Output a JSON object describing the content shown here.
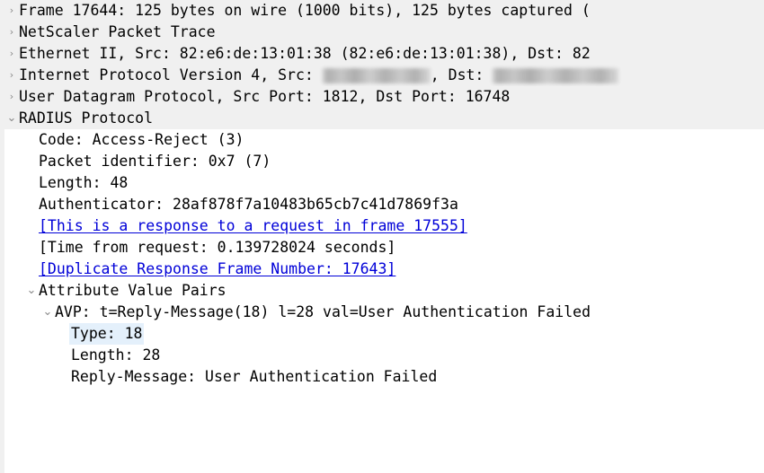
{
  "pane": {
    "name": "Wireshark packet details tree",
    "background": "#ffffff",
    "shaded_row_background": "#f0f0f0",
    "selection_background": "#e4f0fb",
    "link_color": "#0000d8",
    "twisty_collapsed": "›",
    "twisty_expanded": "⌄"
  },
  "rows": [
    {
      "id": "frame",
      "indent": 0,
      "twisty": "collapsed",
      "shaded": true,
      "link": false,
      "selected": false,
      "text": "Frame 17644: 125 bytes on wire (1000 bits), 125 bytes captured ("
    },
    {
      "id": "netscaler-packet-trace",
      "indent": 0,
      "twisty": "collapsed",
      "shaded": true,
      "link": false,
      "selected": false,
      "text": "NetScaler Packet Trace"
    },
    {
      "id": "ethernet-ii",
      "indent": 0,
      "twisty": "collapsed",
      "shaded": true,
      "link": false,
      "selected": false,
      "text": "Ethernet II, Src: 82:e6:de:13:01:38 (82:e6:de:13:01:38), Dst: 82"
    },
    {
      "id": "internet-protocol-version-4",
      "indent": 0,
      "twisty": "collapsed",
      "shaded": true,
      "link": false,
      "selected": false,
      "redacted": true,
      "text_before_src": "Internet Protocol Version 4, Src: ",
      "text_between": ", Dst: ",
      "src_redacted_width": 120,
      "dst_redacted_width": 140
    },
    {
      "id": "user-datagram-protocol",
      "indent": 0,
      "twisty": "collapsed",
      "shaded": true,
      "link": false,
      "selected": false,
      "text": "User Datagram Protocol, Src Port: 1812, Dst Port: 16748"
    },
    {
      "id": "radius-protocol",
      "indent": 0,
      "twisty": "expanded",
      "shaded": true,
      "link": false,
      "selected": false,
      "text": "RADIUS Protocol"
    },
    {
      "id": "radius-code",
      "indent": 1,
      "twisty": "none",
      "shaded": false,
      "link": false,
      "selected": false,
      "text": "Code: Access-Reject (3)"
    },
    {
      "id": "radius-packet-identifier",
      "indent": 1,
      "twisty": "none",
      "shaded": false,
      "link": false,
      "selected": false,
      "text": "Packet identifier: 0x7 (7)"
    },
    {
      "id": "radius-length",
      "indent": 1,
      "twisty": "none",
      "shaded": false,
      "link": false,
      "selected": false,
      "text": "Length: 48"
    },
    {
      "id": "radius-authenticator",
      "indent": 1,
      "twisty": "none",
      "shaded": false,
      "link": false,
      "selected": false,
      "text": "Authenticator: 28af878f7a10483b65cb7c41d7869f3a"
    },
    {
      "id": "response-to-request-frame",
      "indent": 1,
      "twisty": "none",
      "shaded": false,
      "link": true,
      "selected": false,
      "text": "[This is a response to a request in frame 17555]"
    },
    {
      "id": "time-from-request",
      "indent": 1,
      "twisty": "none",
      "shaded": false,
      "link": false,
      "selected": false,
      "text": "[Time from request: 0.139728024 seconds]"
    },
    {
      "id": "duplicate-response-frame-number",
      "indent": 1,
      "twisty": "none",
      "shaded": false,
      "link": true,
      "selected": false,
      "text": "[Duplicate Response Frame Number: 17643]"
    },
    {
      "id": "attribute-value-pairs",
      "indent": 1,
      "twisty": "expanded",
      "shaded": false,
      "link": false,
      "selected": false,
      "text": "Attribute Value Pairs"
    },
    {
      "id": "avp-reply-message",
      "indent": 2,
      "twisty": "expanded",
      "shaded": false,
      "link": false,
      "selected": false,
      "text": "AVP: t=Reply-Message(18) l=28 val=User Authentication Failed"
    },
    {
      "id": "avp-type",
      "indent": 4,
      "twisty": "none",
      "shaded": false,
      "link": false,
      "selected": true,
      "text": "Type: 18"
    },
    {
      "id": "avp-length",
      "indent": 4,
      "twisty": "none",
      "shaded": false,
      "link": false,
      "selected": false,
      "text": "Length: 28"
    },
    {
      "id": "avp-reply-message-value",
      "indent": 4,
      "twisty": "none",
      "shaded": false,
      "link": false,
      "selected": false,
      "text": "Reply-Message: User Authentication Failed"
    }
  ]
}
